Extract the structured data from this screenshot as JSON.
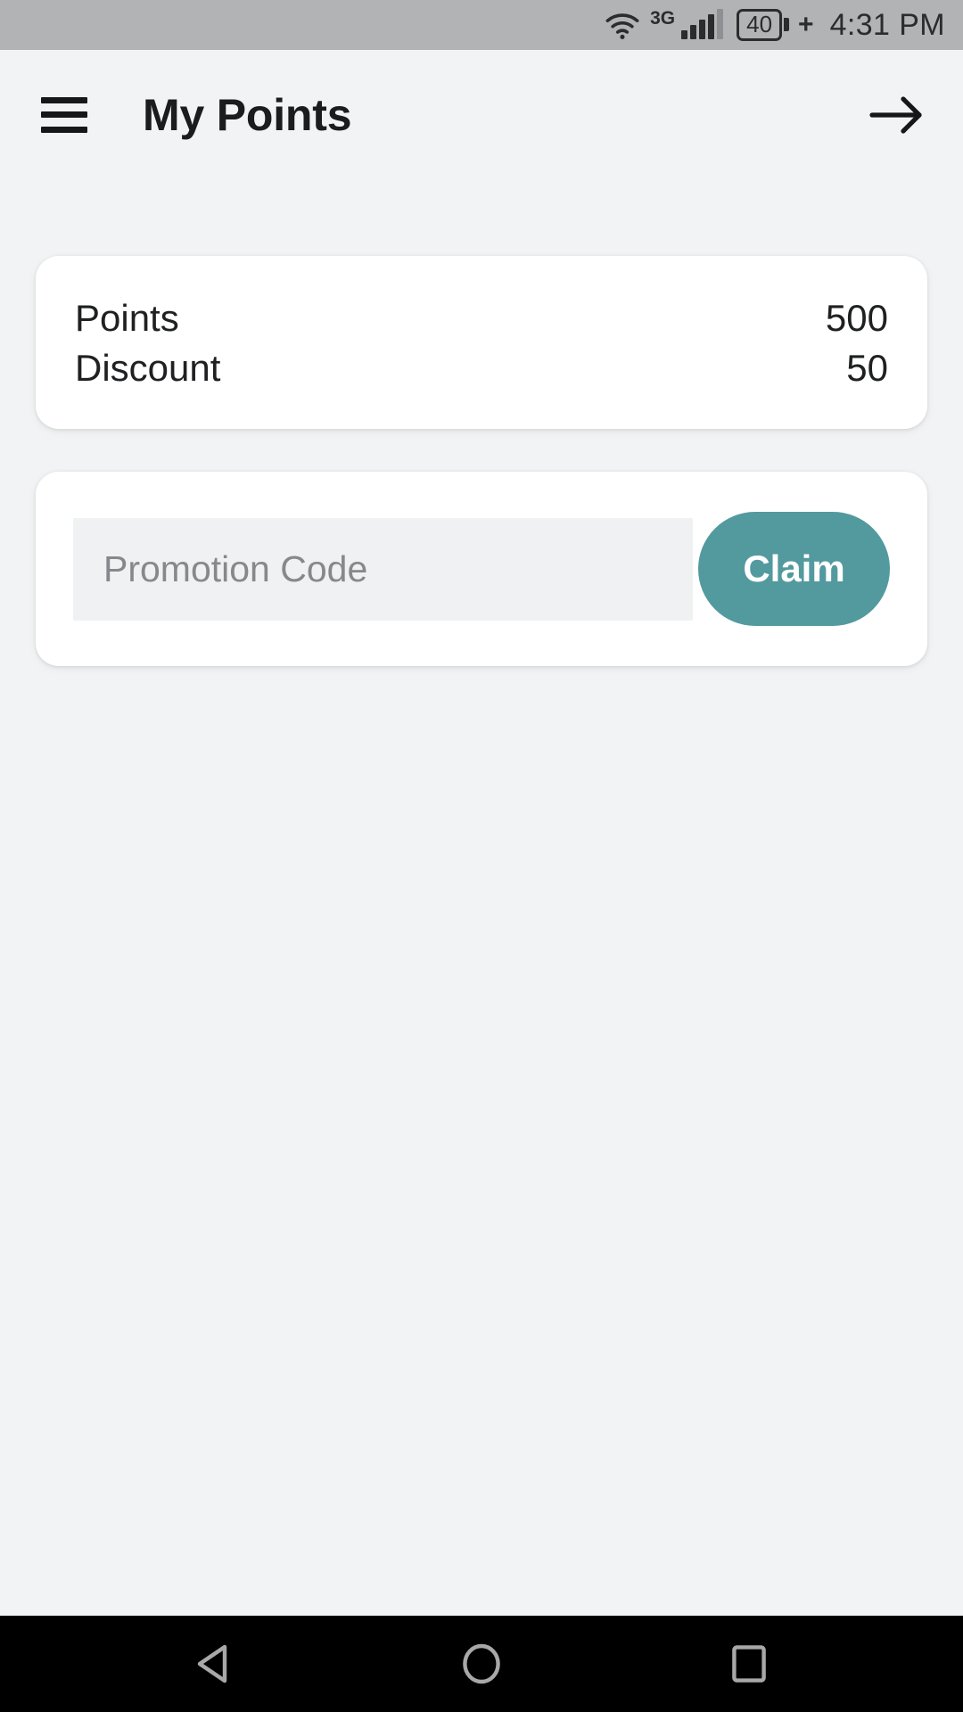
{
  "statusbar": {
    "wifi_icon": "wifi-icon",
    "network_type": "3G",
    "signal_icon": "cellular-signal-icon",
    "signal_bars_filled": 4,
    "signal_bars_total": 5,
    "battery_level": "40",
    "battery_icon": "battery-icon",
    "charging_indicator": "+",
    "time": "4:31 PM",
    "background_color": "#b2b3b5",
    "foreground_color": "#2b2c2e"
  },
  "appbar": {
    "menu_icon": "hamburger-menu-icon",
    "title": "My Points",
    "forward_icon": "arrow-right-icon"
  },
  "points_card": {
    "rows": [
      {
        "label": "Points",
        "value": "500"
      },
      {
        "label": "Discount",
        "value": "50"
      }
    ]
  },
  "promo_card": {
    "input_placeholder": "Promotion Code",
    "input_value": "",
    "claim_label": "Claim",
    "claim_color": "#539a9f"
  },
  "navbar": {
    "back_icon": "triangle-back-icon",
    "home_icon": "circle-home-icon",
    "recents_icon": "square-recents-icon",
    "background_color": "#000000",
    "icon_color": "#a8a8a8"
  },
  "theme": {
    "page_background": "#f1f3f4",
    "card_background": "#ffffff",
    "text_primary": "#1f2021",
    "text_placeholder": "#86898c",
    "accent": "#539a9f"
  }
}
